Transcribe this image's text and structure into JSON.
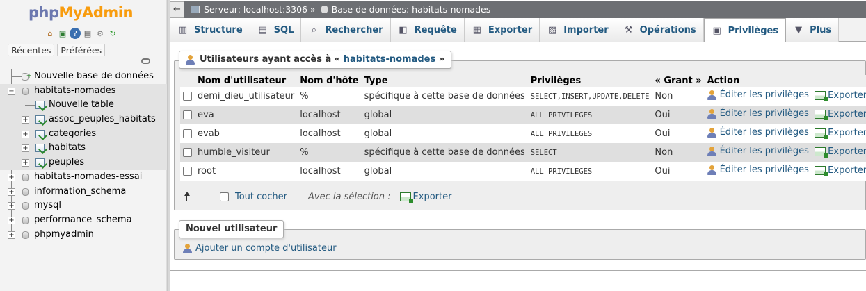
{
  "logo": {
    "part1": "php",
    "part2": "MyAdmin"
  },
  "quick_icons": [
    "home-icon",
    "exit-icon",
    "help-icon",
    "docs-icon",
    "settings-icon",
    "reload-icon"
  ],
  "nav_tabs": [
    "Récentes",
    "Préférées"
  ],
  "tree": [
    {
      "label": "Nouvelle base de données",
      "kind": "new"
    },
    {
      "label": "habitats-nomades",
      "kind": "db",
      "expanded": true
    },
    {
      "label": "Nouvelle table",
      "kind": "newtable"
    },
    {
      "label": "assoc_peuples_habitats",
      "kind": "table"
    },
    {
      "label": "categories",
      "kind": "table"
    },
    {
      "label": "habitats",
      "kind": "table"
    },
    {
      "label": "peuples",
      "kind": "table"
    },
    {
      "label": "habitats-nomades-essai",
      "kind": "db"
    },
    {
      "label": "information_schema",
      "kind": "db"
    },
    {
      "label": "mysql",
      "kind": "db"
    },
    {
      "label": "performance_schema",
      "kind": "db"
    },
    {
      "label": "phpmyadmin",
      "kind": "db"
    }
  ],
  "breadcrumb": {
    "server": "Serveur: localhost:3306",
    "sep": "»",
    "database": "Base de données: habitats-nomades"
  },
  "tabs": [
    {
      "label": "Structure",
      "icon": "▥"
    },
    {
      "label": "SQL",
      "icon": "▤"
    },
    {
      "label": "Rechercher",
      "icon": "⌕"
    },
    {
      "label": "Requête",
      "icon": "◧"
    },
    {
      "label": "Exporter",
      "icon": "▦"
    },
    {
      "label": "Importer",
      "icon": "▨"
    },
    {
      "label": "Opérations",
      "icon": "⚒"
    },
    {
      "label": "Privilèges",
      "icon": "▣"
    },
    {
      "label": "Plus",
      "icon": "▼"
    }
  ],
  "users_section": {
    "legend_prefix": "Utilisateurs ayant accès à « ",
    "db_name": "habitats-nomades",
    "legend_suffix": " »"
  },
  "table": {
    "headers": [
      "",
      "Nom d'utilisateur",
      "Nom d'hôte",
      "Type",
      "Privilèges",
      "« Grant »",
      "Action"
    ],
    "rows": [
      {
        "user": "demi_dieu_utilisateur",
        "host": "%",
        "type": "spécifique à cette base de données",
        "privileges": "SELECT,INSERT,UPDATE,DELETE",
        "grant": "Non"
      },
      {
        "user": "eva",
        "host": "localhost",
        "type": "global",
        "privileges": "ALL PRIVILEGES",
        "grant": "Oui"
      },
      {
        "user": "evab",
        "host": "localhost",
        "type": "global",
        "privileges": "ALL PRIVILEGES",
        "grant": "Oui"
      },
      {
        "user": "humble_visiteur",
        "host": "%",
        "type": "spécifique à cette base de données",
        "privileges": "SELECT",
        "grant": "Non"
      },
      {
        "user": "root",
        "host": "localhost",
        "type": "global",
        "privileges": "ALL PRIVILEGES",
        "grant": "Oui"
      }
    ],
    "edit_label": "Éditer les privilèges",
    "export_label": "Exporter"
  },
  "selection": {
    "check_all": "Tout cocher",
    "with_selected": "Avec la sélection :",
    "export": "Exporter"
  },
  "new_user": {
    "legend": "Nouvel utilisateur",
    "add_link": "Ajouter un compte d'utilisateur"
  }
}
